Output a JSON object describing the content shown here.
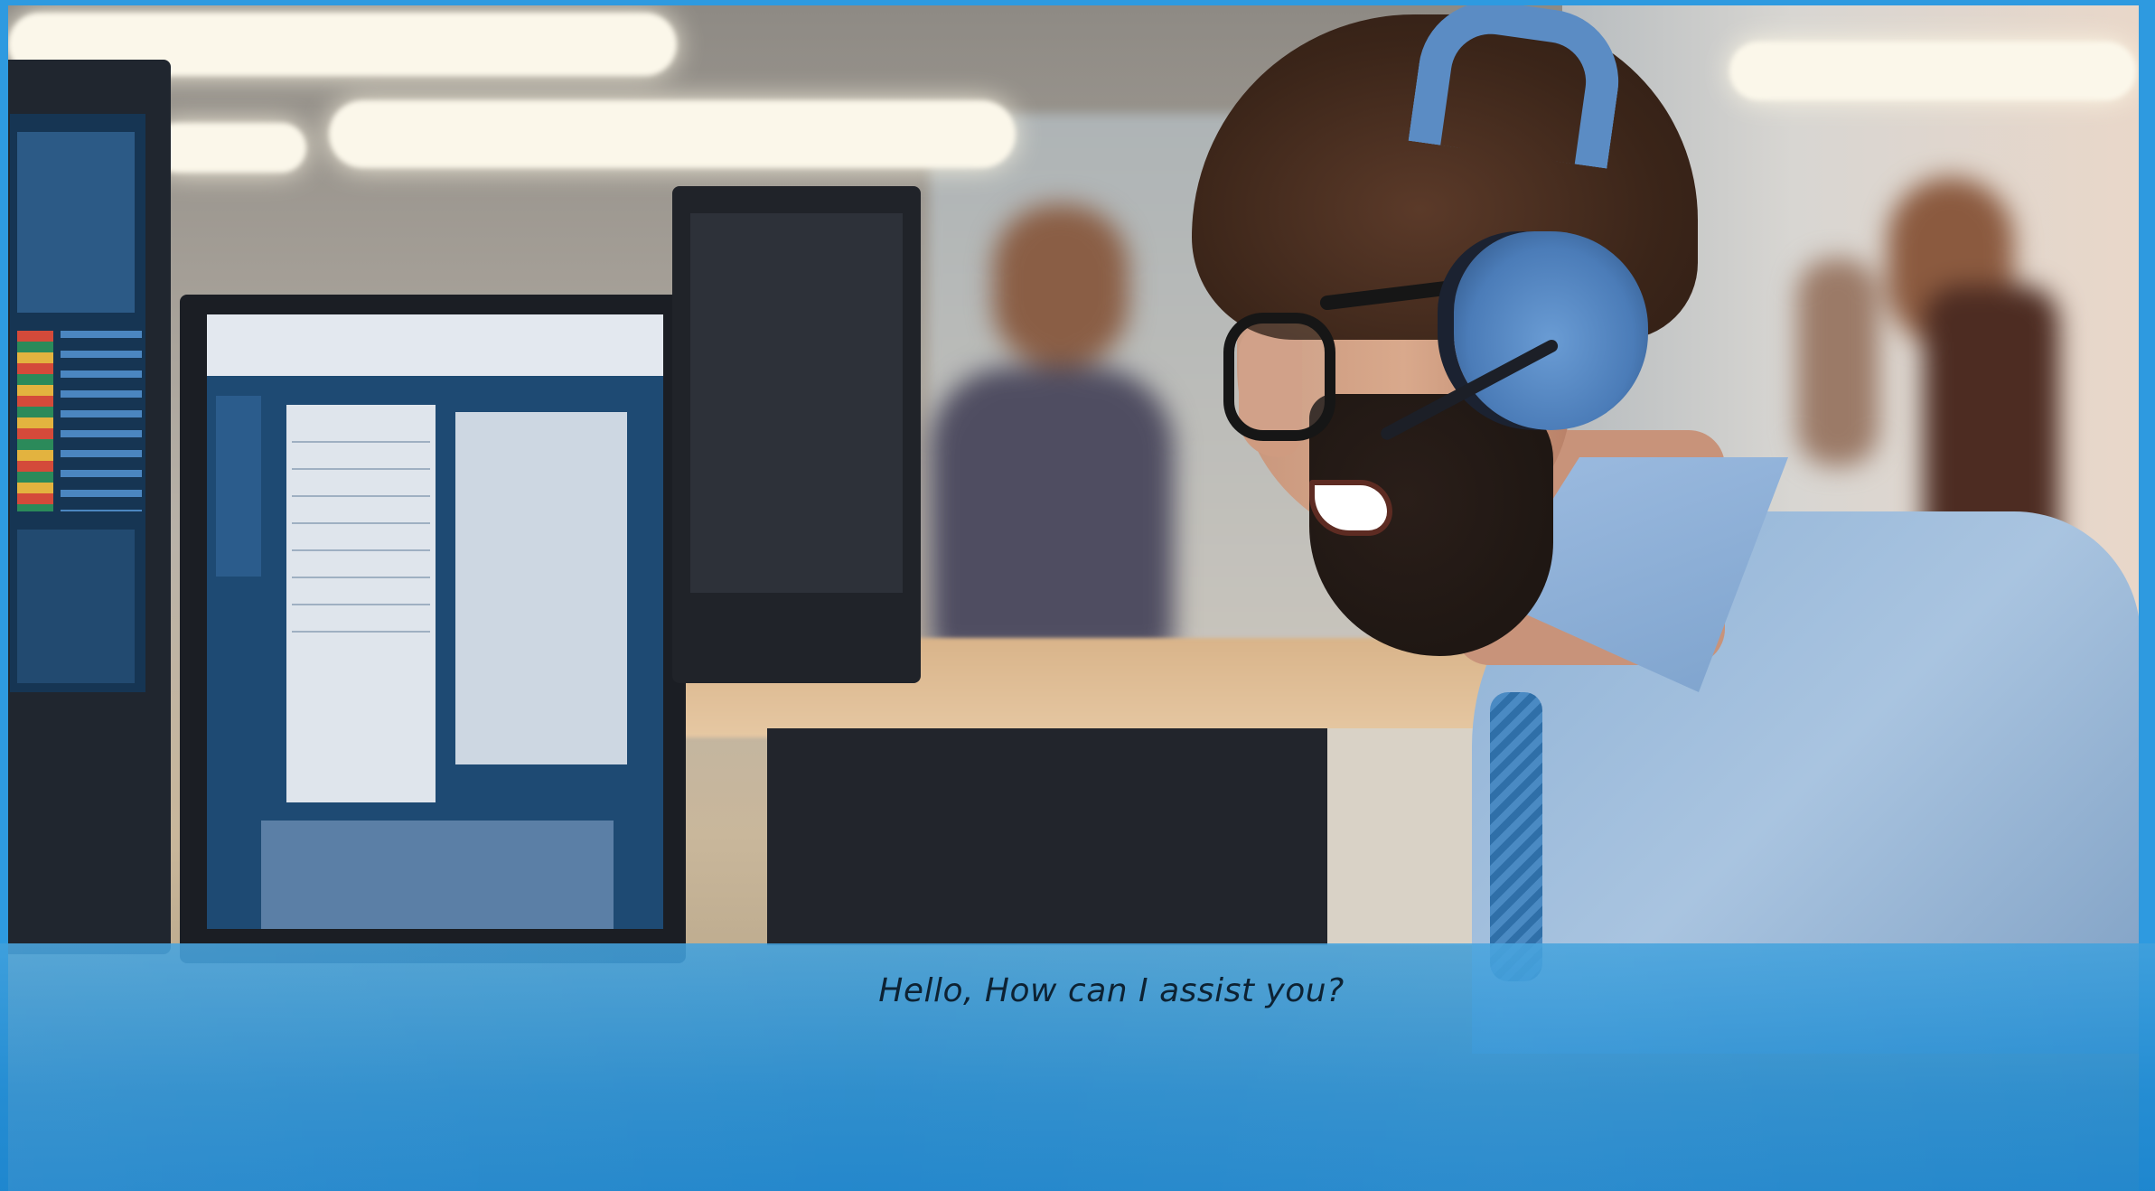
{
  "dialogue": {
    "text": "Hello, How can I assist you?"
  },
  "scene": {
    "description_colors": {
      "frame_border": "#2e9ae0",
      "banner": "#2a93d8",
      "headset": "#5b8cc4",
      "shirt": "#9dbbdc"
    }
  }
}
